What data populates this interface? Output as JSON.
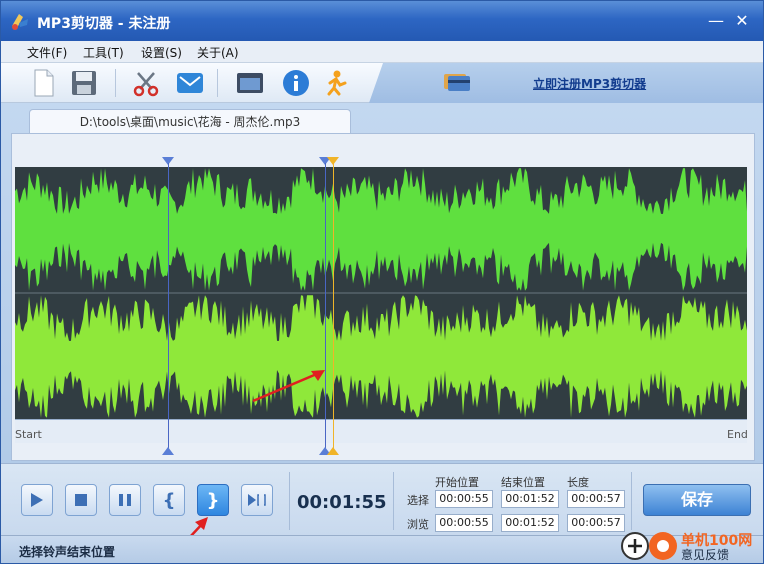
{
  "window": {
    "title": "MP3剪切器 - 未注册",
    "min_glyph": "—",
    "close_glyph": "✕"
  },
  "menu": {
    "items": [
      {
        "label": "文件(F)"
      },
      {
        "label": "工具(T)"
      },
      {
        "label": "设置(S)"
      },
      {
        "label": "关于(A)"
      }
    ]
  },
  "toolbar": {
    "register_link": "立即注册MP3剪切器",
    "icons": [
      "new-file-icon",
      "save-disk-icon",
      "scissors-icon",
      "email-icon",
      "window-icon",
      "info-icon",
      "runner-icon"
    ]
  },
  "file_tab": {
    "label": "D:\\tools\\桌面\\music\\花海 - 周杰伦.mp3"
  },
  "waveform": {
    "start_label": "Start",
    "end_label": "End",
    "wave_color_top": "#5fe03f",
    "wave_color_bottom": "#8fe83a",
    "background_color": "#313d42"
  },
  "transport": {
    "current_time": "00:01:55",
    "buttons": [
      "play",
      "stop",
      "pause",
      "set-start",
      "set-end",
      "play-to-end"
    ],
    "set_start_glyph": "{",
    "set_end_glyph": "}"
  },
  "time_grid": {
    "headers": [
      "开始位置",
      "结束位置",
      "长度"
    ],
    "rows": [
      {
        "label": "选择",
        "start": "00:00:55",
        "end": "00:01:52",
        "length": "00:00:57"
      },
      {
        "label": "浏览",
        "start": "00:00:55",
        "end": "00:01:52",
        "length": "00:00:57"
      }
    ]
  },
  "save_button": {
    "label": "保存"
  },
  "status": {
    "text": "选择铃声结束位置"
  },
  "watermark": {
    "text": "单机100网",
    "sub_text": "意见反馈"
  }
}
